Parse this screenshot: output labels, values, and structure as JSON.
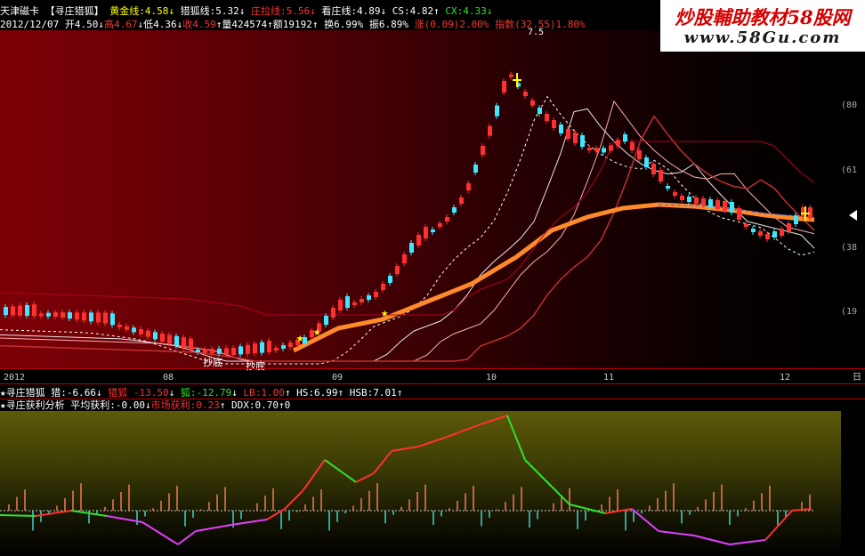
{
  "header": {
    "stock_name": "天津磁卡",
    "indicator_name": "【寻庄猎狐】",
    "gold_line": {
      "label": "黄金线:",
      "value": "4.58",
      "arrow": "↓"
    },
    "fox_line": {
      "label": "猎狐线:",
      "value": "5.32",
      "arrow": "↓"
    },
    "dealer_line": {
      "label": "庄拉线:",
      "value": "5.56",
      "arrow": "↓"
    },
    "watch_line": {
      "label": "看庄线:",
      "value": "4.89",
      "arrow": "↓"
    },
    "cs": {
      "label": "CS:",
      "value": "4.82",
      "arrow": "↑"
    },
    "cx": {
      "label": "CX:",
      "value": "4.33",
      "arrow": "↓"
    }
  },
  "quote": {
    "date": "2012/12/07",
    "open": {
      "label": "开",
      "value": "4.50",
      "arrow": "↓"
    },
    "high": {
      "label": "高",
      "value": "4.67",
      "arrow": "↓"
    },
    "low": {
      "label": "低",
      "value": "4.36",
      "arrow": "↓"
    },
    "close": {
      "label": "收",
      "value": "4.59",
      "arrow": "↑"
    },
    "volume": {
      "label": "量",
      "value": "424574",
      "arrow": "↑"
    },
    "amount": {
      "label": "额",
      "value": "19192",
      "arrow": "↑"
    },
    "turnover": {
      "label": "换",
      "value": "6.99%"
    },
    "amplitude": {
      "label": "振",
      "value": "6.89%"
    },
    "change": {
      "label": "涨",
      "value": "(0.09)",
      "pct": "2.00%"
    },
    "index": {
      "label": "指数",
      "value": "(32.55)",
      "pct": "1.80%"
    }
  },
  "main_chart": {
    "peak_label": "7.5",
    "markers": [
      {
        "text": "抄底"
      },
      {
        "text": "抄底"
      }
    ],
    "right_axis": [
      "(80",
      "(61",
      "(38",
      "(19"
    ],
    "date_axis": [
      "2012",
      "08",
      "09",
      "10",
      "11",
      "12"
    ],
    "date_axis_end": "日"
  },
  "osc_header_1": {
    "title": "寻庄猎狐",
    "lie": {
      "label": "猎:",
      "value": "-6.66",
      "arrow": "↓"
    },
    "cao": {
      "label": "猎狐",
      "value": "-13.50",
      "arrow": "↓"
    },
    "hu": {
      "label": "狐:",
      "value": "-12.79",
      "arrow": "↓"
    },
    "lb": {
      "label": "LB:",
      "value": "1.00",
      "arrow": "↑"
    },
    "hs": {
      "label": "HS:",
      "value": "6.99",
      "arrow": "↑"
    },
    "hsb": {
      "label": "HSB:",
      "value": "7.01",
      "arrow": "↑"
    }
  },
  "osc_header_2": {
    "title": "寻庄获利分析",
    "avg": {
      "label": "平均获利:",
      "value": "-0.00",
      "arrow": "↓"
    },
    "market": {
      "label": "市场获利:",
      "value": "0.23",
      "arrow": "↑"
    },
    "ddx": {
      "label": "DDX:",
      "value": "0.70",
      "arrow": "↑"
    },
    "last": "0"
  },
  "watermark": {
    "line1": "炒股輔助教材58股网",
    "line2": "www.58Gu.com"
  },
  "colors": {
    "red": "#ff3030",
    "cyan": "#40e8ff",
    "yellow": "#ffff00",
    "white": "#ffffff",
    "orange": "#ff8a2a",
    "green": "#30e030",
    "magenta": "#e040ff"
  }
}
